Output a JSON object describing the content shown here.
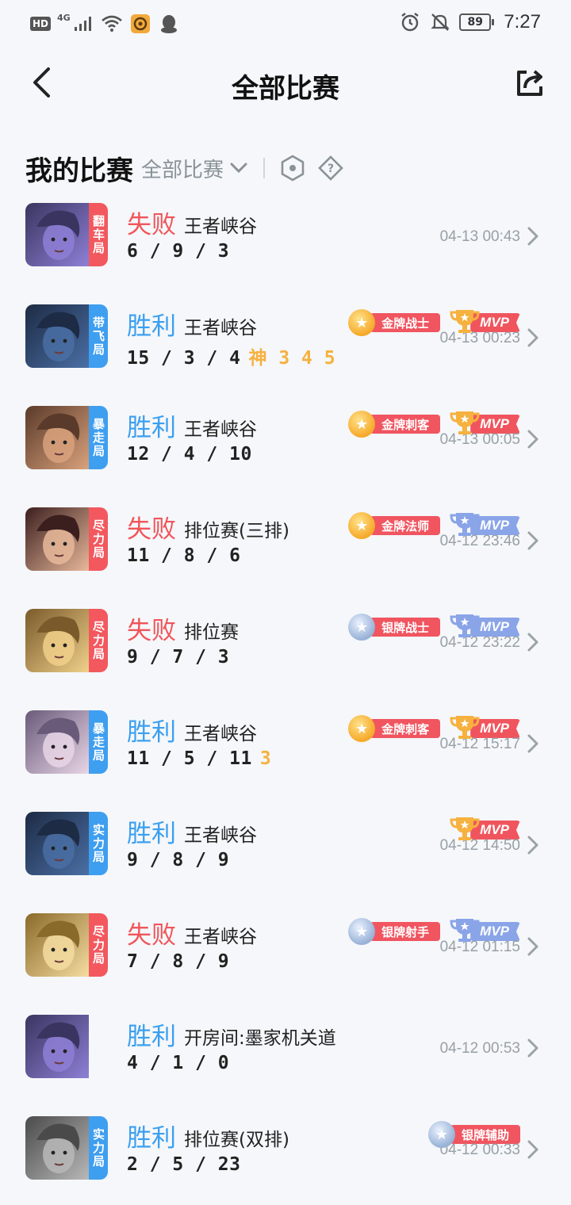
{
  "status_bar": {
    "hd": "HD",
    "network": "4G",
    "battery": "89",
    "time": "7:27"
  },
  "header": {
    "title": "全部比赛"
  },
  "section": {
    "title": "我的比赛",
    "filter": "全部比赛"
  },
  "colors": {
    "win": "#3b9ff0",
    "loss": "#f0555a",
    "tag_red": "#f2585e",
    "tag_blue": "#3e9ef0",
    "streak": "#f6b13f"
  },
  "matches": [
    {
      "tag": "翻车局",
      "tag_color": "red",
      "result": "失败",
      "result_type": "loss",
      "mode": "王者峡谷",
      "kda": "6 / 9 / 3",
      "extra": "",
      "badge": "",
      "badge_tier": "",
      "mvp": "",
      "time": "04-13 00:43",
      "avatar_tone": [
        "#3a3560",
        "#8e7fd6"
      ]
    },
    {
      "tag": "带飞局",
      "tag_color": "blue",
      "result": "胜利",
      "result_type": "win",
      "mode": "王者峡谷",
      "kda": "15 / 3 / 4",
      "extra": "神 3 4 5",
      "badge": "金牌战士",
      "badge_tier": "gold",
      "mvp": "MVP",
      "mvp_tier": "gold",
      "time": "04-13 00:23",
      "avatar_tone": [
        "#1d2b44",
        "#4a6fa5"
      ]
    },
    {
      "tag": "暴走局",
      "tag_color": "blue",
      "result": "胜利",
      "result_type": "win",
      "mode": "王者峡谷",
      "kda": "12 / 4 / 10",
      "extra": "",
      "badge": "金牌刺客",
      "badge_tier": "gold",
      "mvp": "MVP",
      "mvp_tier": "gold",
      "time": "04-13 00:05",
      "avatar_tone": [
        "#5a3a2a",
        "#d9a27c"
      ]
    },
    {
      "tag": "尽力局",
      "tag_color": "red",
      "result": "失败",
      "result_type": "loss",
      "mode": "排位赛(三排)",
      "kda": "11 / 8 / 6",
      "extra": "",
      "badge": "金牌法师",
      "badge_tier": "gold",
      "mvp": "MVP",
      "mvp_tier": "blue",
      "time": "04-12 23:46",
      "avatar_tone": [
        "#3b1f1f",
        "#e8b89a"
      ]
    },
    {
      "tag": "尽力局",
      "tag_color": "red",
      "result": "失败",
      "result_type": "loss",
      "mode": "排位赛",
      "kda": "9 / 7 / 3",
      "extra": "",
      "badge": "银牌战士",
      "badge_tier": "silver",
      "mvp": "MVP",
      "mvp_tier": "blue",
      "time": "04-12 23:22",
      "avatar_tone": [
        "#7a5a2a",
        "#f0d08a"
      ]
    },
    {
      "tag": "暴走局",
      "tag_color": "blue",
      "result": "胜利",
      "result_type": "win",
      "mode": "王者峡谷",
      "kda": "11 / 5 / 11",
      "extra": "3",
      "badge": "金牌刺客",
      "badge_tier": "gold",
      "mvp": "MVP",
      "mvp_tier": "gold",
      "time": "04-12 15:17",
      "avatar_tone": [
        "#6a5a7a",
        "#e8d6e6"
      ]
    },
    {
      "tag": "实力局",
      "tag_color": "blue",
      "result": "胜利",
      "result_type": "win",
      "mode": "王者峡谷",
      "kda": "9 / 8 / 9",
      "extra": "",
      "badge": "",
      "badge_tier": "",
      "mvp": "MVP",
      "mvp_tier": "gold",
      "time": "04-12 14:50",
      "avatar_tone": [
        "#1d2b44",
        "#4a6fa5"
      ]
    },
    {
      "tag": "尽力局",
      "tag_color": "red",
      "result": "失败",
      "result_type": "loss",
      "mode": "王者峡谷",
      "kda": "7 / 8 / 9",
      "extra": "",
      "badge": "银牌射手",
      "badge_tier": "silver",
      "mvp": "MVP",
      "mvp_tier": "blue",
      "time": "04-12 01:15",
      "avatar_tone": [
        "#8a6a2a",
        "#f5dca0"
      ]
    },
    {
      "tag": "",
      "tag_color": "",
      "result": "胜利",
      "result_type": "win",
      "mode": "开房间:墨家机关道",
      "kda": "4 / 1 / 0",
      "extra": "",
      "badge": "",
      "badge_tier": "",
      "mvp": "",
      "time": "04-12 00:53",
      "avatar_tone": [
        "#3a3560",
        "#8e7fd6"
      ]
    },
    {
      "tag": "实力局",
      "tag_color": "blue",
      "result": "胜利",
      "result_type": "win",
      "mode": "排位赛(双排)",
      "kda": "2 / 5 / 23",
      "extra": "",
      "badge": "银牌辅助",
      "badge_tier": "silver",
      "mvp": "",
      "time": "04-12 00:33",
      "avatar_tone": [
        "#4a4a4a",
        "#b8b8b8"
      ]
    }
  ]
}
